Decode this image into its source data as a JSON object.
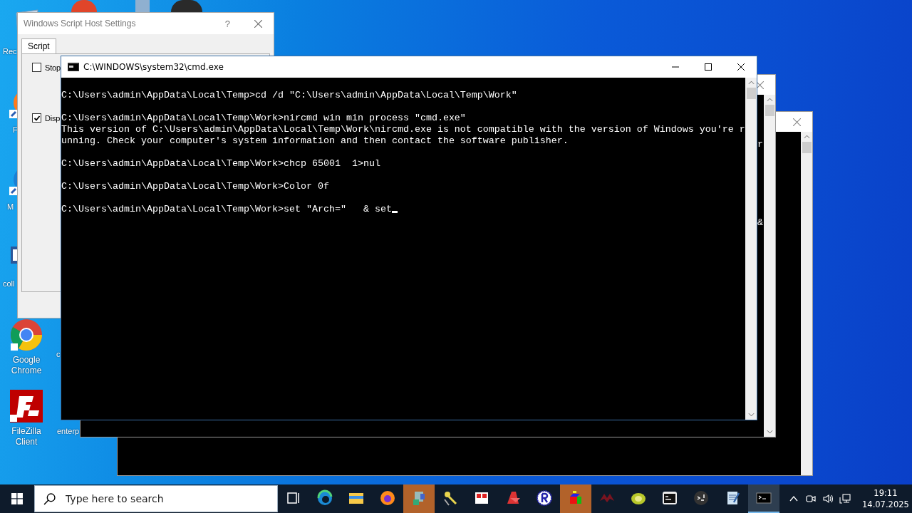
{
  "desktop_icons": [
    {
      "kind": "bin",
      "label": "Rec"
    },
    {
      "kind": "firefox",
      "label": "F"
    },
    {
      "kind": "edge",
      "label": "M"
    },
    {
      "kind": "word",
      "label": "coll"
    },
    {
      "kind": "chrome",
      "label": "Google Chrome"
    },
    {
      "kind": "filezilla",
      "label": "FileZilla Client"
    }
  ],
  "desktop_labels_second_column": [
    "c",
    "enterp"
  ],
  "dialog": {
    "title": "Windows Script Host Settings",
    "help": "?",
    "tabs": [
      {
        "label": "Script",
        "selected": true
      }
    ],
    "options": [
      {
        "label": "Stop",
        "checked": false
      },
      {
        "label": "Disp",
        "checked": true
      }
    ]
  },
  "back_windows": [
    {
      "chars": [
        "r",
        "&"
      ]
    }
  ],
  "console": {
    "title": "C:\\WINDOWS\\system32\\cmd.exe",
    "cursor": true,
    "blocks": [
      [
        "C:\\Users\\admin\\AppData\\Local\\Temp>cd /d \"C:\\Users\\admin\\AppData\\Local\\Temp\\Work\""
      ],
      [
        "C:\\Users\\admin\\AppData\\Local\\Temp\\Work>nircmd win min process \"cmd.exe\"",
        "This version of C:\\Users\\admin\\AppData\\Local\\Temp\\Work\\nircmd.exe is not compatible with the version of Windows you're r",
        "unning. Check your computer's system information and then contact the software publisher."
      ],
      [
        "C:\\Users\\admin\\AppData\\Local\\Temp\\Work>chcp 65001  1>nul"
      ],
      [
        "C:\\Users\\admin\\AppData\\Local\\Temp\\Work>Color 0f"
      ],
      [
        "C:\\Users\\admin\\AppData\\Local\\Temp\\Work>set \"Arch=\"   & set"
      ]
    ]
  },
  "taskbar": {
    "search_placeholder": "Type here to search",
    "apps": [
      {
        "kind": "taskview",
        "highlighted": false,
        "selected": false
      },
      {
        "kind": "edge",
        "highlighted": false,
        "selected": false
      },
      {
        "kind": "folder",
        "highlighted": false,
        "selected": false
      },
      {
        "kind": "firefox",
        "highlighted": false,
        "selected": false
      },
      {
        "kind": "installer",
        "highlighted": true,
        "selected": false
      },
      {
        "kind": "keys",
        "highlighted": false,
        "selected": false
      },
      {
        "kind": "calendar",
        "highlighted": false,
        "selected": false
      },
      {
        "kind": "redapp",
        "highlighted": false,
        "selected": false
      },
      {
        "kind": "rcircle",
        "highlighted": false,
        "selected": false
      },
      {
        "kind": "cube",
        "highlighted": true,
        "selected": false
      },
      {
        "kind": "bat",
        "highlighted": false,
        "selected": false
      },
      {
        "kind": "kiwi",
        "highlighted": false,
        "selected": false
      },
      {
        "kind": "cmd",
        "highlighted": false,
        "selected": false
      },
      {
        "kind": "shell",
        "highlighted": false,
        "selected": false
      },
      {
        "kind": "notepad",
        "highlighted": false,
        "selected": false
      },
      {
        "kind": "console",
        "highlighted": false,
        "selected": true
      }
    ],
    "clock": {
      "time": "19:11",
      "date": "14.07.2025"
    }
  }
}
